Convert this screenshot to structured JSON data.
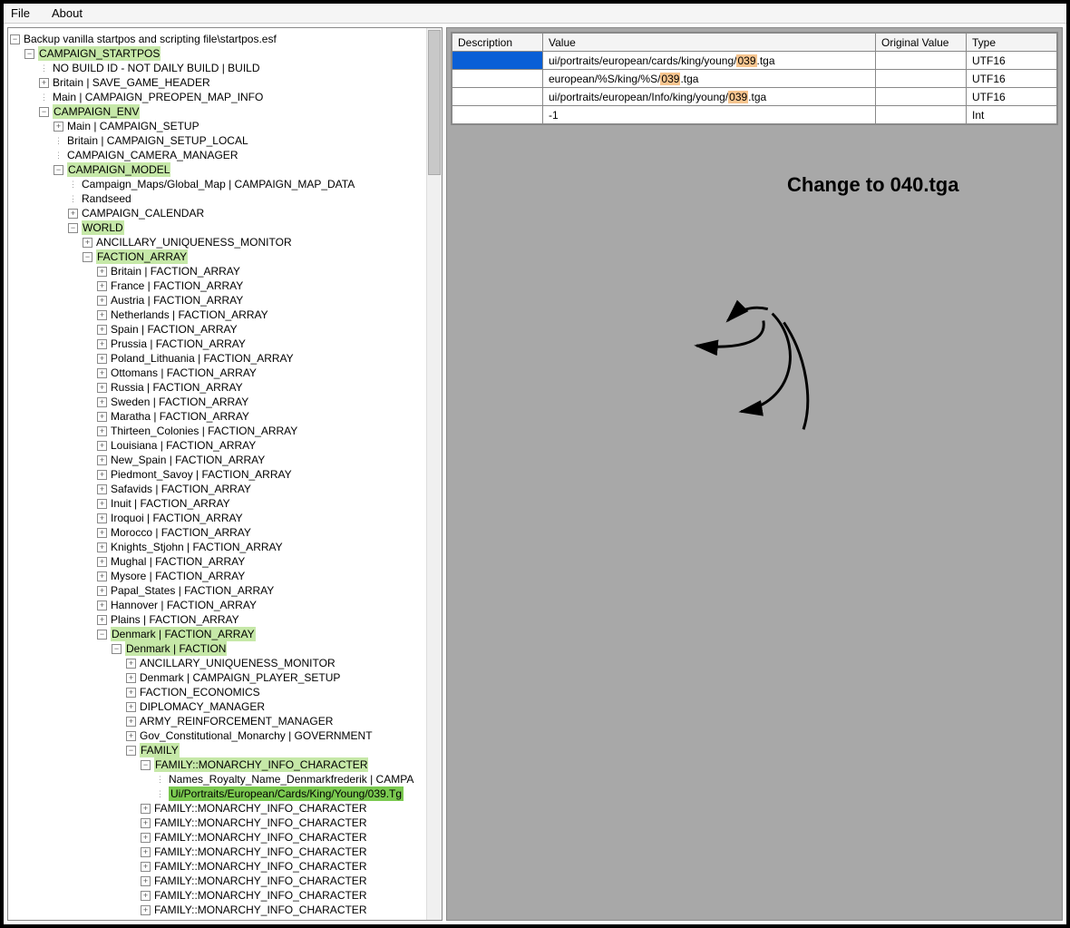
{
  "menu": {
    "file": "File",
    "about": "About"
  },
  "tree": {
    "root": "Backup vanilla startpos and scripting file\\startpos.esf",
    "n1": "CAMPAIGN_STARTPOS",
    "n1a": "NO BUILD ID - NOT DAILY BUILD | BUILD",
    "n1b": "Britain | SAVE_GAME_HEADER",
    "n1c": "Main | CAMPAIGN_PREOPEN_MAP_INFO",
    "n2": "CAMPAIGN_ENV",
    "n2a": "Main | CAMPAIGN_SETUP",
    "n2b": "Britain | CAMPAIGN_SETUP_LOCAL",
    "n2c": "CAMPAIGN_CAMERA_MANAGER",
    "n3": "CAMPAIGN_MODEL",
    "n3a": "Campaign_Maps/Global_Map | CAMPAIGN_MAP_DATA",
    "n3b": "Randseed",
    "n3c": "CAMPAIGN_CALENDAR",
    "n4": "WORLD",
    "n4a": "ANCILLARY_UNIQUENESS_MONITOR",
    "n5": "FACTION_ARRAY",
    "f0": "Britain | FACTION_ARRAY",
    "f1": "France | FACTION_ARRAY",
    "f2": "Austria | FACTION_ARRAY",
    "f3": "Netherlands | FACTION_ARRAY",
    "f4": "Spain | FACTION_ARRAY",
    "f5": "Prussia | FACTION_ARRAY",
    "f6": "Poland_Lithuania | FACTION_ARRAY",
    "f7": "Ottomans | FACTION_ARRAY",
    "f8": "Russia | FACTION_ARRAY",
    "f9": "Sweden | FACTION_ARRAY",
    "f10": "Maratha | FACTION_ARRAY",
    "f11": "Thirteen_Colonies | FACTION_ARRAY",
    "f12": "Louisiana | FACTION_ARRAY",
    "f13": "New_Spain | FACTION_ARRAY",
    "f14": "Piedmont_Savoy | FACTION_ARRAY",
    "f15": "Safavids | FACTION_ARRAY",
    "f16": "Inuit | FACTION_ARRAY",
    "f17": "Iroquoi | FACTION_ARRAY",
    "f18": "Morocco | FACTION_ARRAY",
    "f19": "Knights_Stjohn | FACTION_ARRAY",
    "f20": "Mughal | FACTION_ARRAY",
    "f21": "Mysore | FACTION_ARRAY",
    "f22": "Papal_States | FACTION_ARRAY",
    "f23": "Hannover | FACTION_ARRAY",
    "f24": "Plains | FACTION_ARRAY",
    "f25": "Denmark | FACTION_ARRAY",
    "f25a": "Denmark | FACTION",
    "d0": "ANCILLARY_UNIQUENESS_MONITOR",
    "d1": "Denmark | CAMPAIGN_PLAYER_SETUP",
    "d2": "FACTION_ECONOMICS",
    "d3": "DIPLOMACY_MANAGER",
    "d4": "ARMY_REINFORCEMENT_MANAGER",
    "d5": "Gov_Constitutional_Monarchy | GOVERNMENT",
    "d6": "FAMILY",
    "d6a": "FAMILY::MONARCHY_INFO_CHARACTER",
    "d6a1": "Names_Royalty_Name_Denmarkfrederik | CAMPA",
    "d6a2": "Ui/Portraits/European/Cards/King/Young/039.Tg",
    "mic": "FAMILY::MONARCHY_INFO_CHARACTER"
  },
  "grid": {
    "h0": "Description",
    "h1": "Value",
    "h2": "Original Value",
    "h3": "Type",
    "rows": [
      {
        "desc": "",
        "pre": "ui/portraits/european/cards/king/young/",
        "num": "039",
        "post": ".tga",
        "orig": "",
        "type": "UTF16"
      },
      {
        "desc": "",
        "pre": "european/%S/king/%S/",
        "num": "039",
        "post": ".tga",
        "orig": "",
        "type": "UTF16"
      },
      {
        "desc": "",
        "pre": "ui/portraits/european/Info/king/young/",
        "num": "039",
        "post": ".tga",
        "orig": "",
        "type": "UTF16"
      },
      {
        "desc": "",
        "pre": "-1",
        "num": "",
        "post": "",
        "orig": "",
        "type": "Int"
      }
    ]
  },
  "annotation": "Change to 040.tga"
}
